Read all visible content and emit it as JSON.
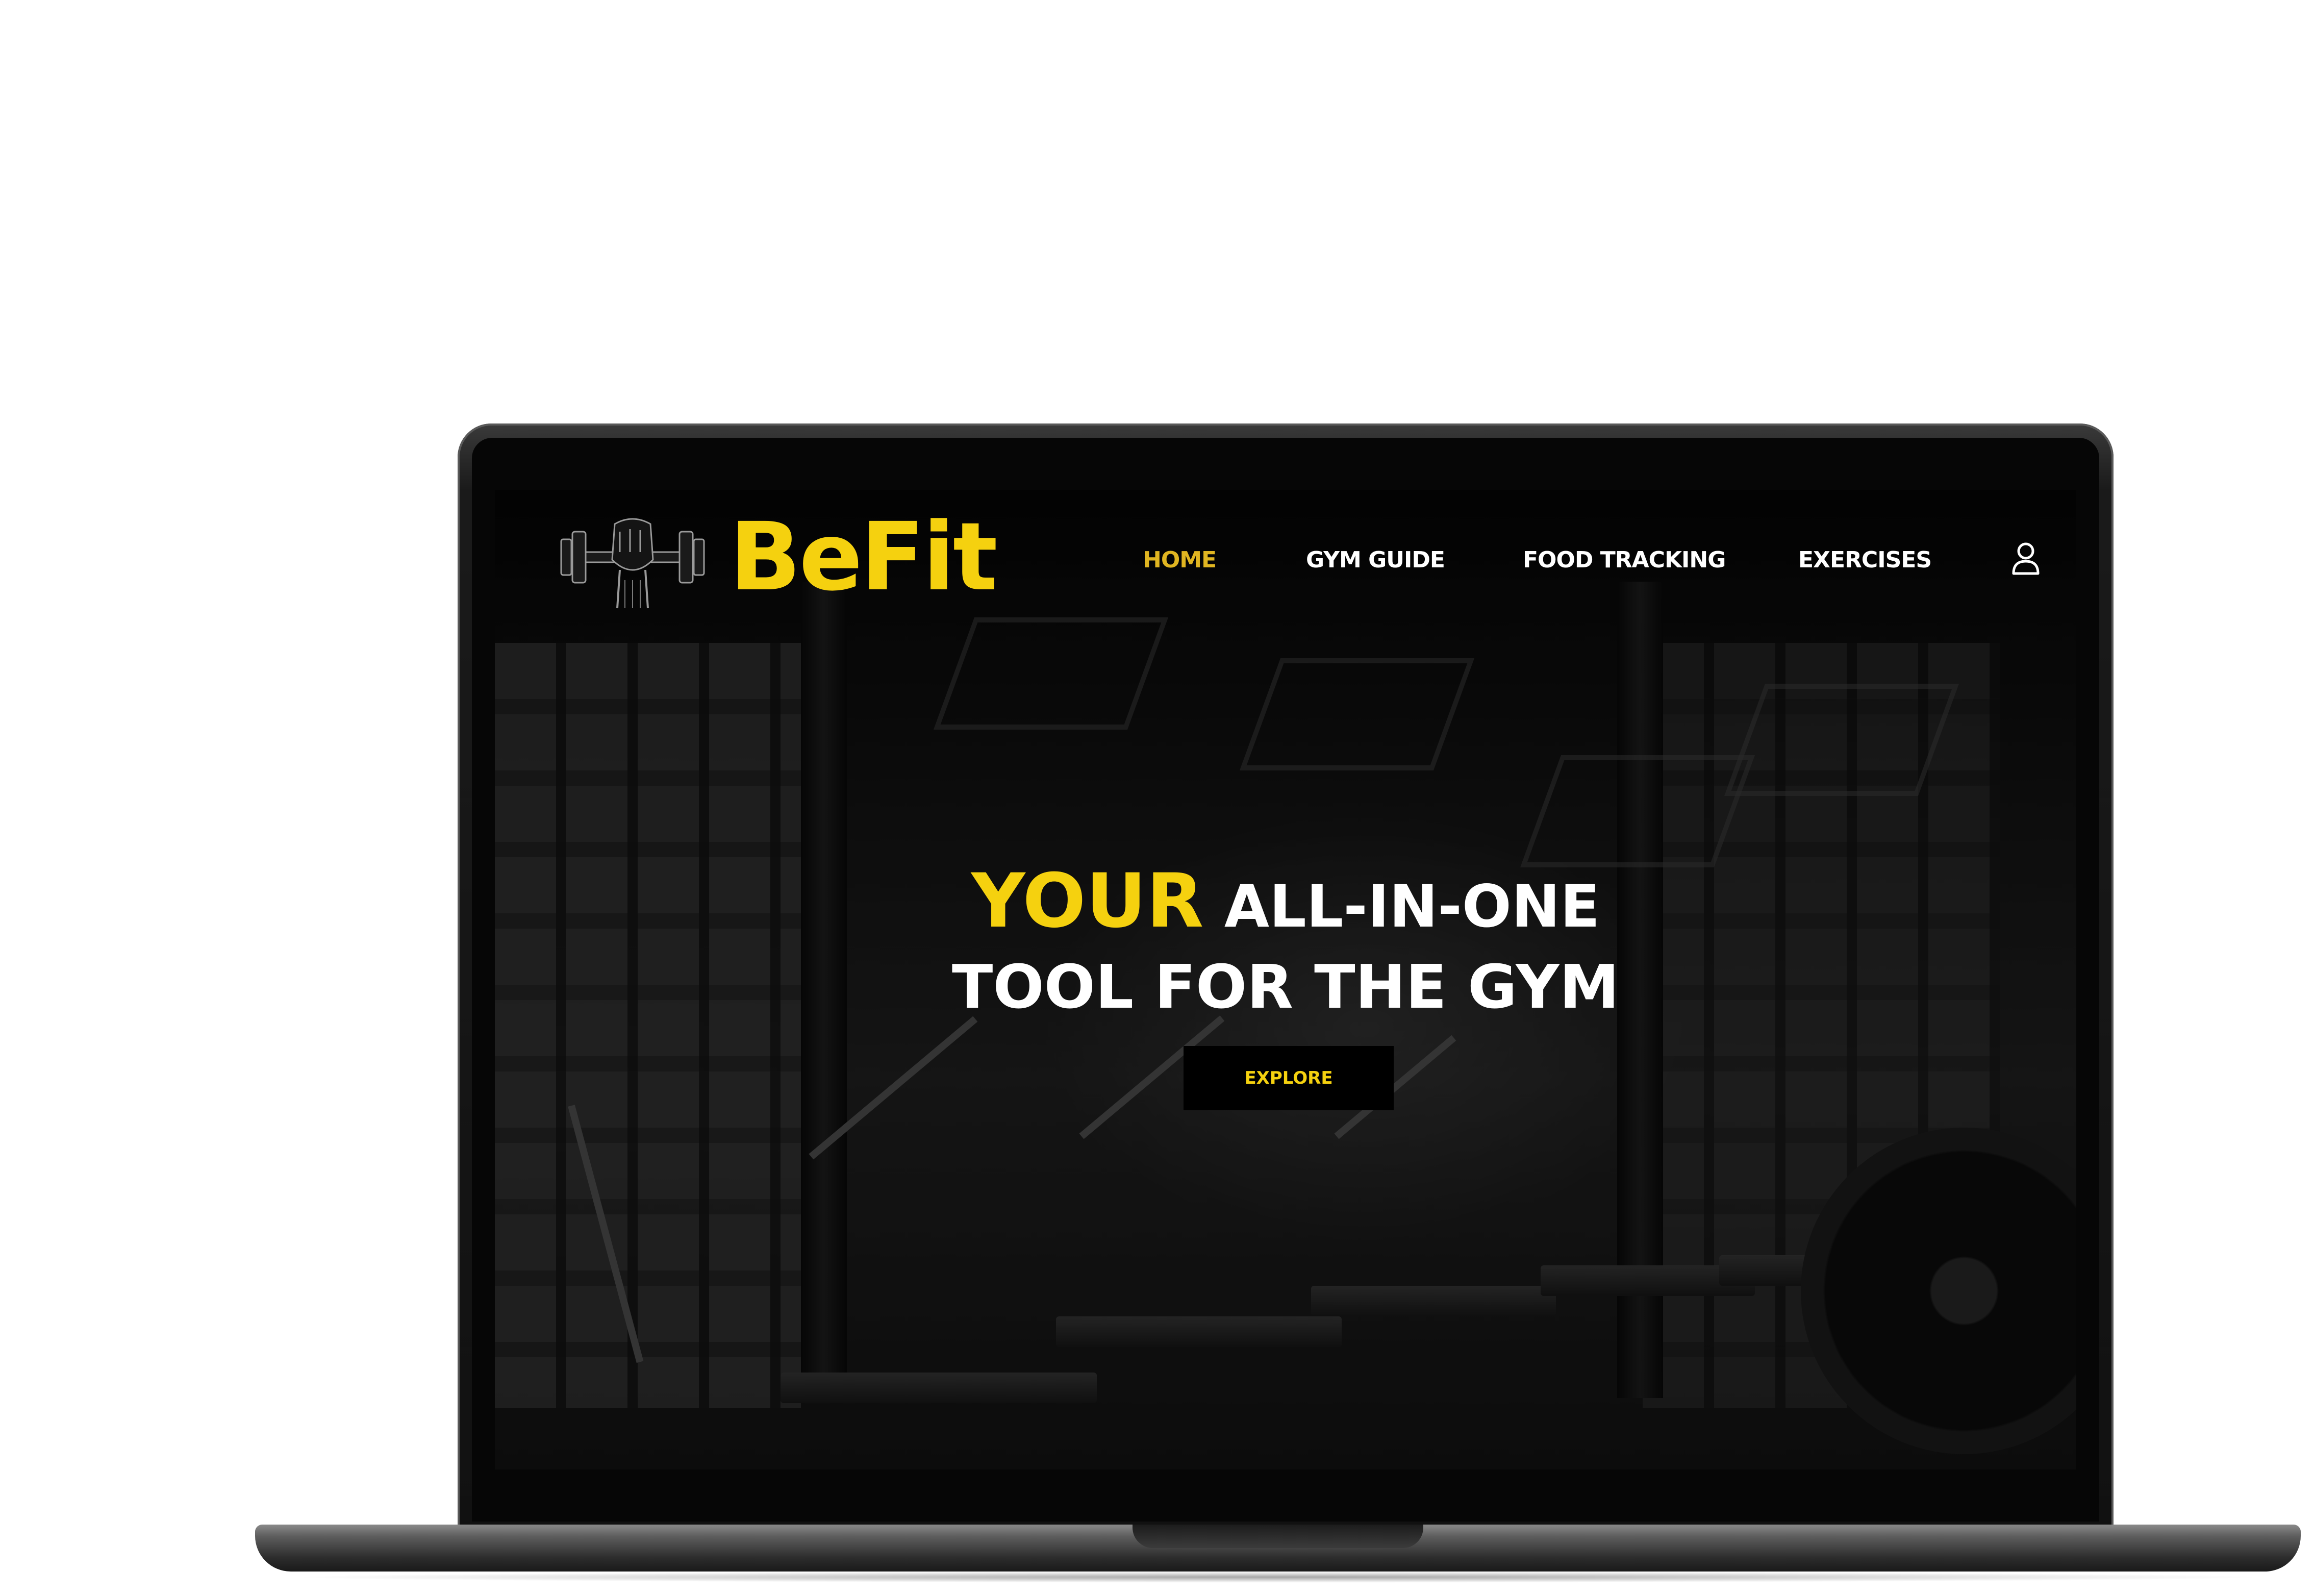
{
  "brand": {
    "name": "BeFit",
    "logo_icon": "dumbbell-fist-icon",
    "accent_color": "#f5d10f"
  },
  "nav": {
    "items": [
      {
        "label": "HOME",
        "active": true
      },
      {
        "label": "GYM GUIDE",
        "active": false
      },
      {
        "label": "FOOD TRACKING",
        "active": false
      },
      {
        "label": "EXERCISES",
        "active": false
      }
    ],
    "user_icon": "user-icon"
  },
  "hero": {
    "accent_word": "YOUR",
    "line1_rest": "ALL-IN-ONE",
    "line2": "TOOL FOR THE GYM",
    "cta_label": "EXPLORE"
  },
  "colors": {
    "background": "#ffffff",
    "screen_bg": "#0b0b0b",
    "nav_active": "#e0b521",
    "text": "#ffffff"
  }
}
